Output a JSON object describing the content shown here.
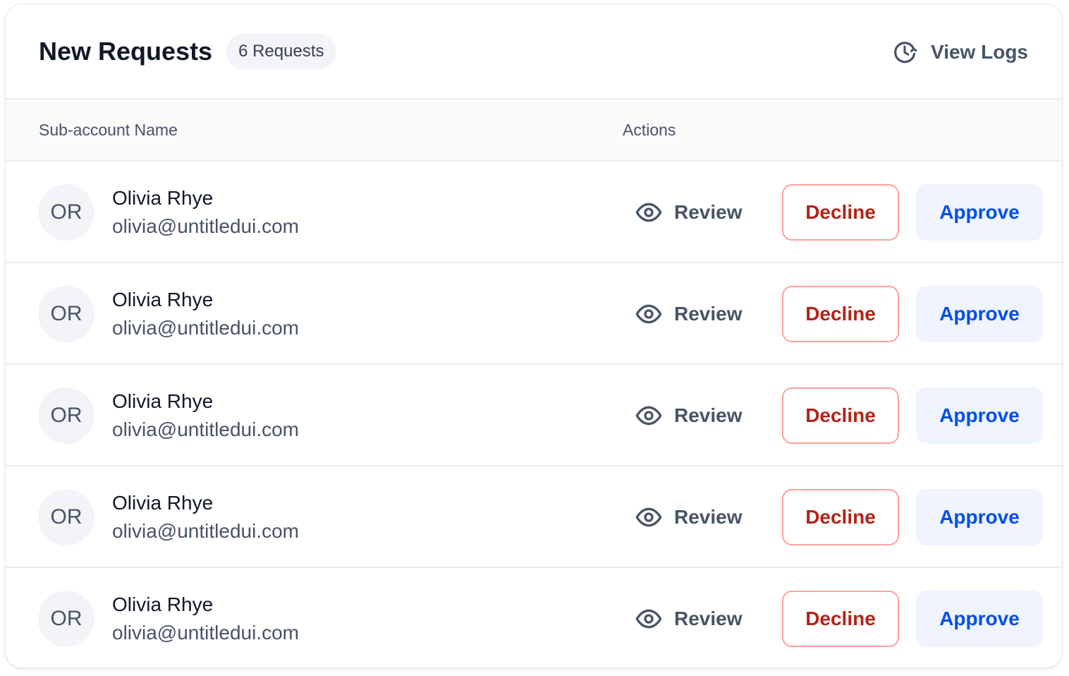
{
  "header": {
    "title": "New Requests",
    "badge": "6 Requests",
    "view_logs_label": "View Logs",
    "view_logs_icon": "clock-refresh-icon"
  },
  "table": {
    "columns": [
      "Sub-account Name",
      "Actions"
    ],
    "rows": [
      {
        "initials": "OR",
        "name": "Olivia Rhye",
        "email": "olivia@untitledui.com",
        "review": "Review",
        "decline": "Decline",
        "approve": "Approve"
      },
      {
        "initials": "OR",
        "name": "Olivia Rhye",
        "email": "olivia@untitledui.com",
        "review": "Review",
        "decline": "Decline",
        "approve": "Approve"
      },
      {
        "initials": "OR",
        "name": "Olivia Rhye",
        "email": "olivia@untitledui.com",
        "review": "Review",
        "decline": "Decline",
        "approve": "Approve"
      },
      {
        "initials": "OR",
        "name": "Olivia Rhye",
        "email": "olivia@untitledui.com",
        "review": "Review",
        "decline": "Decline",
        "approve": "Approve"
      },
      {
        "initials": "OR",
        "name": "Olivia Rhye",
        "email": "olivia@untitledui.com",
        "review": "Review",
        "decline": "Decline",
        "approve": "Approve"
      }
    ]
  },
  "colors": {
    "decline_text": "#b42318",
    "decline_border": "#fda29b",
    "approve_text": "#004eeb",
    "approve_bg": "#eff4ff"
  }
}
